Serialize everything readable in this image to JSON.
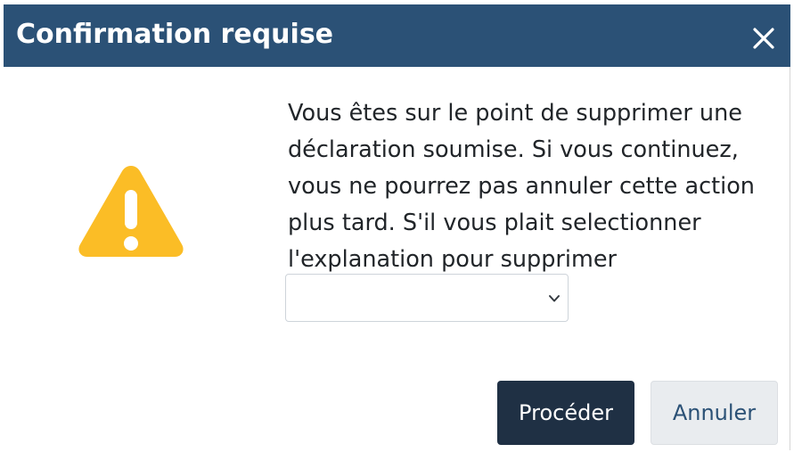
{
  "dialog": {
    "title": "Confirmation requise",
    "close_icon": "close-icon",
    "warning_icon": "warning-triangle-icon",
    "message_lines": [
      "Vous êtes sur le point de supprimer une",
      "déclaration soumise. Si vous continuez,",
      "vous ne pourrez pas annuler cette action",
      "plus tard. S'il vous plait selectionner",
      "l'explanation pour supprimer"
    ],
    "reason_select": {
      "value": ""
    },
    "proceed_label": "Procéder",
    "cancel_label": "Annuler"
  },
  "colors": {
    "header_bg": "#2b5176",
    "warning": "#fbbd26",
    "proceed_bg": "#1f3044",
    "cancel_bg": "#e9ecef",
    "cancel_text": "#2b5176"
  }
}
